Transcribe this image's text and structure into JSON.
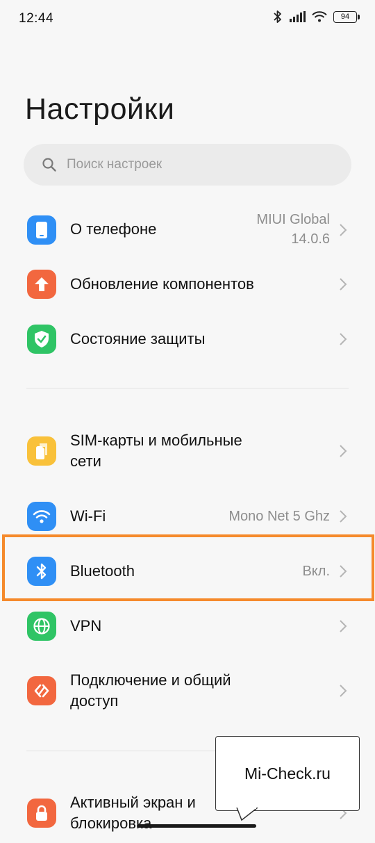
{
  "status_bar": {
    "time": "12:44",
    "battery_level": "94"
  },
  "page_title": "Настройки",
  "search": {
    "placeholder": "Поиск настроек"
  },
  "items": [
    {
      "label": "О телефоне",
      "value_line1": "MIUI Global",
      "value_line2": "14.0.6",
      "icon": "phone-icon",
      "color": "#2f8ff5"
    },
    {
      "label": "Обновление компонентов",
      "icon": "arrow-up-icon",
      "color": "#f2673f"
    },
    {
      "label": "Состояние защиты",
      "icon": "shield-check-icon",
      "color": "#2fc465"
    },
    {
      "label_line1": "SIM-карты и мобильные",
      "label_line2": "сети",
      "icon": "sim-cards-icon",
      "color": "#f9c13a"
    },
    {
      "label": "Wi-Fi",
      "value": "Mono Net 5 Ghz",
      "icon": "wifi-icon",
      "color": "#2f8ff5"
    },
    {
      "label": "Bluetooth",
      "value": "Вкл.",
      "icon": "bluetooth-icon",
      "color": "#2f8ff5",
      "highlighted": true
    },
    {
      "label": "VPN",
      "icon": "globe-icon",
      "color": "#2fc465"
    },
    {
      "label_line1": "Подключение и общий",
      "label_line2": "доступ",
      "icon": "sharing-icon",
      "color": "#f2673f"
    },
    {
      "label_line1": "Активный экран и",
      "label_line2": "блокировка",
      "icon": "lock-icon",
      "color": "#f2673f"
    }
  ],
  "watermark": "Mi-Check.ru",
  "colors": {
    "highlight": "#f58a2c",
    "blue": "#2f8ff5",
    "orange": "#f2673f",
    "green": "#2fc465",
    "yellow": "#f9c13a"
  }
}
